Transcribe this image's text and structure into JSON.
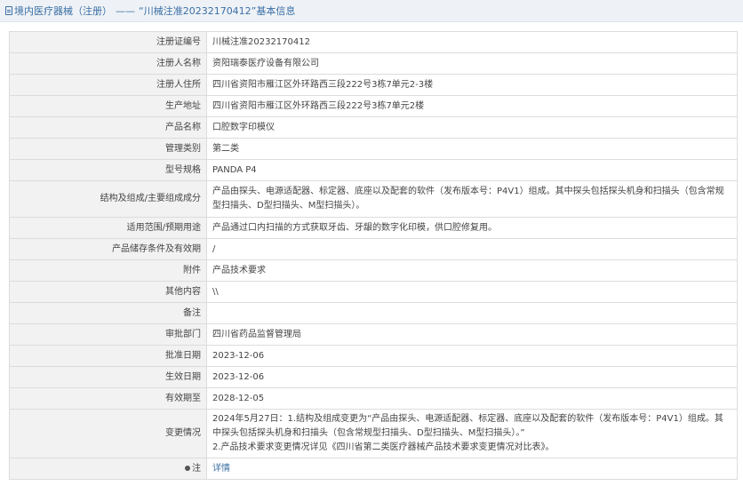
{
  "header": {
    "breadcrumb_root": "境内医疗器械（注册）",
    "separator": "——",
    "breadcrumb_current": "“川械注准20232170412”基本信息"
  },
  "rows": [
    {
      "label": "注册证编号",
      "value": "川械注准20232170412"
    },
    {
      "label": "注册人名称",
      "value": "资阳瑞泰医疗设备有限公司"
    },
    {
      "label": "注册人住所",
      "value": "四川省资阳市雁江区外环路西三段222号3栋7单元2-3楼"
    },
    {
      "label": "生产地址",
      "value": "四川省资阳市雁江区外环路西三段222号3栋7单元2楼"
    },
    {
      "label": "产品名称",
      "value": "口腔数字印模仪"
    },
    {
      "label": "管理类别",
      "value": "第二类"
    },
    {
      "label": "型号规格",
      "value": "PANDA P4"
    },
    {
      "label": "结构及组成/主要组成成分",
      "value": "产品由探头、电源适配器、标定器、底座以及配套的软件（发布版本号：P4V1）组成。其中探头包括探头机身和扫描头（包含常规型扫描头、D型扫描头、M型扫描头）。"
    },
    {
      "label": "适用范围/预期用途",
      "value": "产品通过口内扫描的方式获取牙齿、牙龈的数字化印模，供口腔修复用。"
    },
    {
      "label": "产品储存条件及有效期",
      "value": "/"
    },
    {
      "label": "附件",
      "value": "产品技术要求"
    },
    {
      "label": "其他内容",
      "value": "\\\\"
    },
    {
      "label": "备注",
      "value": ""
    },
    {
      "label": "审批部门",
      "value": "四川省药品监督管理局"
    },
    {
      "label": "批准日期",
      "value": "2023-12-06"
    },
    {
      "label": "生效日期",
      "value": "2023-12-06"
    },
    {
      "label": "有效期至",
      "value": "2028-12-05"
    }
  ],
  "change": {
    "label": "变更情况",
    "line1": "2024年5月27日：1.结构及组成变更为“产品由探头、电源适配器、标定器、底座以及配套的软件（发布版本号：P4V1）组成。其中探头包括探头机身和扫描头（包含常规型扫描头、D型扫描头、M型扫描头）。”",
    "line2": "2.产品技术要求变更情况详见《四川省第二类医疗器械产品技术要求变更情况对比表》。"
  },
  "footer_row": {
    "label": "注",
    "icon": "pin-icon",
    "link": "详情"
  }
}
